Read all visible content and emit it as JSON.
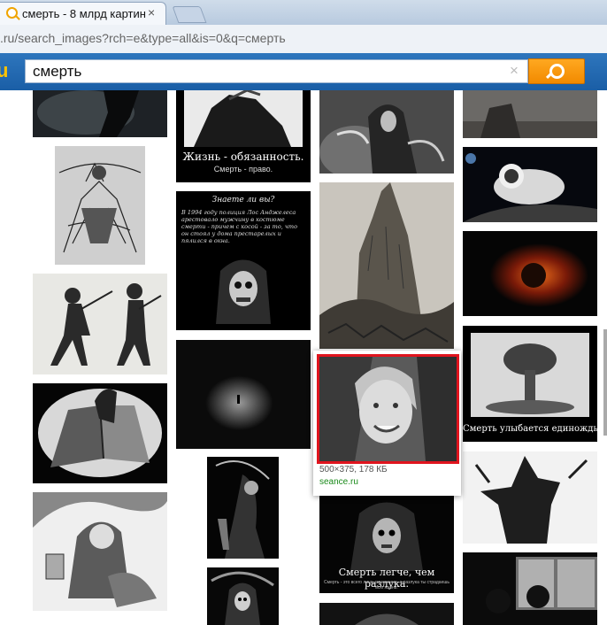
{
  "browser": {
    "tab_title": "смерть - 8 млрд картино",
    "tab_close": "×",
    "url": ".ru/search_images?rch=e&type=all&is=0&q=смерть"
  },
  "search": {
    "logo_fragment": "u",
    "query": "смерть",
    "clear_label": "×"
  },
  "captions": {
    "demotivator_1": "Жизнь - обязанность.",
    "demotivator_1_sub": "Смерть - право.",
    "quiz_title": "Знаете ли вы?",
    "quiz_text": "В 1994 году полиция Лос Анджелеса арестовало мужчину в костюме смерти - причем с косой - за то, что он стоял у дома престарелых и пялился в окна.",
    "demotivator_2": "Смерть улыбается единожды.",
    "demotivator_3": "Смерть легче, чем разлука.",
    "demotivator_3_sub": "Смерть - это всего лишь мгновение, а разлука ты страдаешь всю жизнь."
  },
  "hover": {
    "size": "500×375, 178 КБ",
    "site": "seance.ru"
  },
  "icons": [
    "search-favicon-icon",
    "close-icon",
    "new-tab-icon",
    "clear-icon",
    "search-icon"
  ],
  "colors": {
    "searchbar": "#2166b0",
    "search_button": "#f7960f",
    "highlight": "#e0141e",
    "site_link": "#1a8a1a"
  }
}
